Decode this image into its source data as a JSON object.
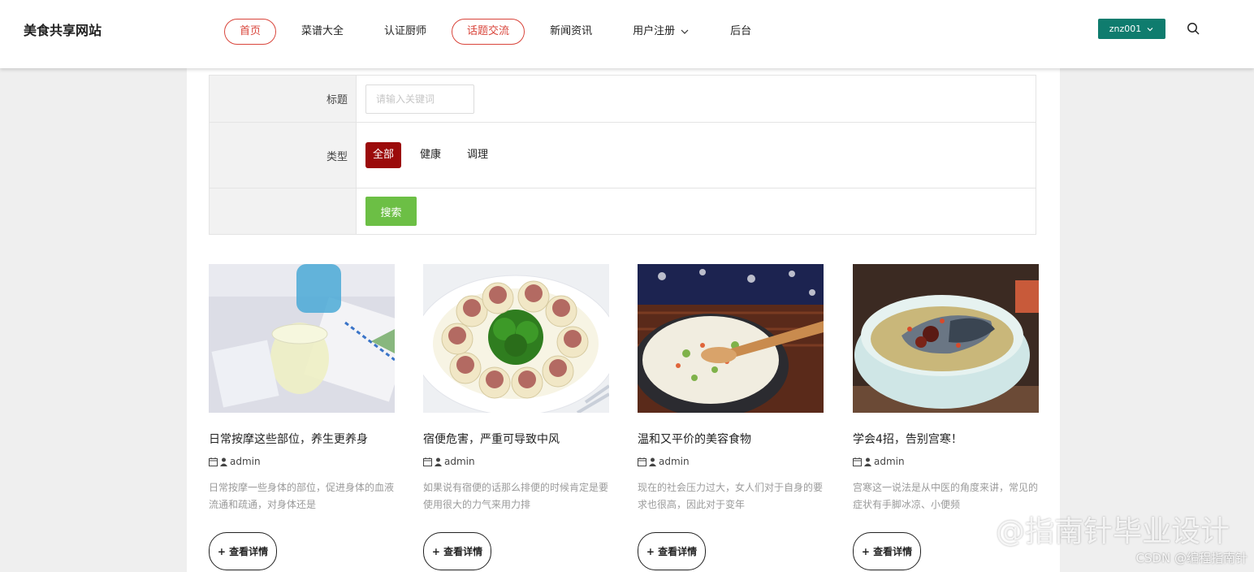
{
  "header": {
    "logo": "美食共享网站",
    "nav": [
      {
        "label": "首页",
        "outlined": true
      },
      {
        "label": "菜谱大全",
        "outlined": false
      },
      {
        "label": "认证厨师",
        "outlined": false
      },
      {
        "label": "话题交流",
        "outlined": true
      },
      {
        "label": "新闻资讯",
        "outlined": false
      },
      {
        "label": "用户注册",
        "outlined": false,
        "dropdown": true
      },
      {
        "label": "后台",
        "outlined": false
      }
    ],
    "user": "znz001"
  },
  "filter": {
    "title_label": "标题",
    "keyword_placeholder": "请输入关键词",
    "type_label": "类型",
    "types": [
      "全部",
      "健康",
      "调理"
    ],
    "active_type": "全部",
    "search_label": "搜索"
  },
  "cards": [
    {
      "title": "日常按摩这些部位，养生更养身",
      "author": "admin",
      "desc": "日常按摩一些身体的部位，促进身体的血液流通和疏通，对身体还是",
      "button": "+ 查看详情",
      "image": "lemon-drink"
    },
    {
      "title": "宿便危害，严重可导致中风",
      "author": "admin",
      "desc": "如果说有宿便的话那么排便的时候肯定是要使用很大的力气来用力排",
      "button": "+ 查看详情",
      "image": "meat-radish-broccoli"
    },
    {
      "title": "温和又平价的美容食物",
      "author": "admin",
      "desc": "现在的社会压力过大，女人们对于自身的要求也很高，因此对于变年",
      "button": "+ 查看详情",
      "image": "porridge-bowl"
    },
    {
      "title": "学会4招，告别宫寒！",
      "author": "admin",
      "desc": "宫寒这一说法是从中医的角度来讲，常见的症状有手脚冰凉、小便频",
      "button": "+ 查看详情",
      "image": "fish-soup"
    }
  ],
  "watermark": {
    "main": "@指南针毕业设计",
    "sub": "CSDN @编程指南针"
  },
  "colors": {
    "accent_red": "#d9453b",
    "active_type": "#9b0b0b",
    "search_green": "#6cbf45",
    "user_teal": "#0f7c6e"
  }
}
